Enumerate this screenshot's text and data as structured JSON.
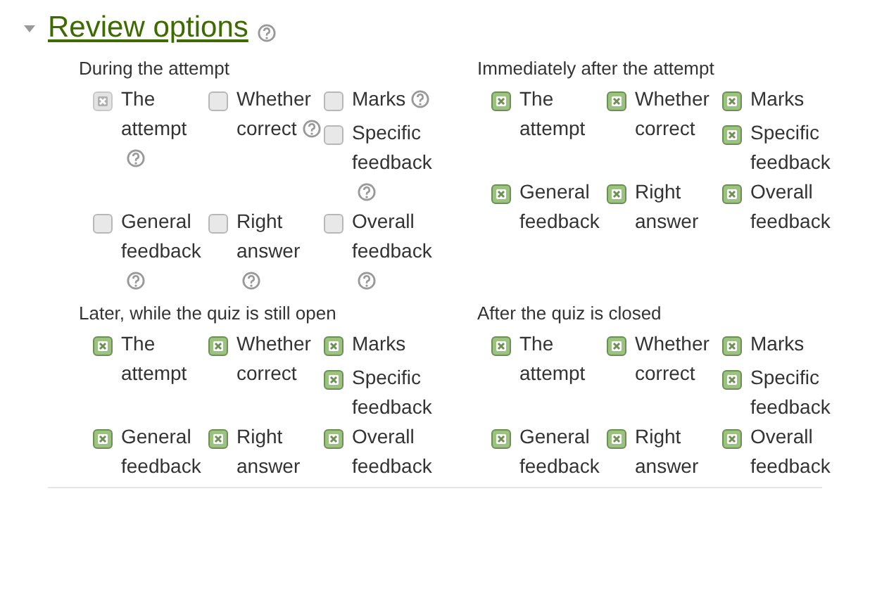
{
  "section": {
    "title": "Review options",
    "expanded": true,
    "help": true
  },
  "groups": [
    {
      "title": "During the attempt",
      "items": [
        {
          "label": "The attempt",
          "checked": true,
          "disabled": true,
          "help": true
        },
        {
          "label": "Whether correct",
          "checked": false,
          "disabled": false,
          "help": true
        },
        {
          "label": "Marks",
          "checked": false,
          "disabled": false,
          "help": true
        },
        {
          "label": "Specific feedback",
          "checked": false,
          "disabled": false,
          "help": true
        },
        {
          "label": "General feedback",
          "checked": false,
          "disabled": false,
          "help": true
        },
        {
          "label": "Right answer",
          "checked": false,
          "disabled": false,
          "help": true
        },
        {
          "label": "Overall feedback",
          "checked": false,
          "disabled": false,
          "help": true
        }
      ]
    },
    {
      "title": "Immediately after the attempt",
      "items": [
        {
          "label": "The attempt",
          "checked": true,
          "disabled": false,
          "help": false
        },
        {
          "label": "Whether correct",
          "checked": true,
          "disabled": false,
          "help": false
        },
        {
          "label": "Marks",
          "checked": true,
          "disabled": false,
          "help": false
        },
        {
          "label": "Specific feedback",
          "checked": true,
          "disabled": false,
          "help": false
        },
        {
          "label": "General feedback",
          "checked": true,
          "disabled": false,
          "help": false
        },
        {
          "label": "Right answer",
          "checked": true,
          "disabled": false,
          "help": false
        },
        {
          "label": "Overall feedback",
          "checked": true,
          "disabled": false,
          "help": false
        }
      ]
    },
    {
      "title": "Later, while the quiz is still open",
      "items": [
        {
          "label": "The attempt",
          "checked": true,
          "disabled": false,
          "help": false
        },
        {
          "label": "Whether correct",
          "checked": true,
          "disabled": false,
          "help": false
        },
        {
          "label": "Marks",
          "checked": true,
          "disabled": false,
          "help": false
        },
        {
          "label": "Specific feedback",
          "checked": true,
          "disabled": false,
          "help": false
        },
        {
          "label": "General feedback",
          "checked": true,
          "disabled": false,
          "help": false
        },
        {
          "label": "Right answer",
          "checked": true,
          "disabled": false,
          "help": false
        },
        {
          "label": "Overall feedback",
          "checked": true,
          "disabled": false,
          "help": false
        }
      ]
    },
    {
      "title": "After the quiz is closed",
      "items": [
        {
          "label": "The attempt",
          "checked": true,
          "disabled": false,
          "help": false
        },
        {
          "label": "Whether correct",
          "checked": true,
          "disabled": false,
          "help": false
        },
        {
          "label": "Marks",
          "checked": true,
          "disabled": false,
          "help": false
        },
        {
          "label": "Specific feedback",
          "checked": true,
          "disabled": false,
          "help": false
        },
        {
          "label": "General feedback",
          "checked": true,
          "disabled": false,
          "help": false
        },
        {
          "label": "Right answer",
          "checked": true,
          "disabled": false,
          "help": false
        },
        {
          "label": "Overall feedback",
          "checked": true,
          "disabled": false,
          "help": false
        }
      ]
    }
  ]
}
